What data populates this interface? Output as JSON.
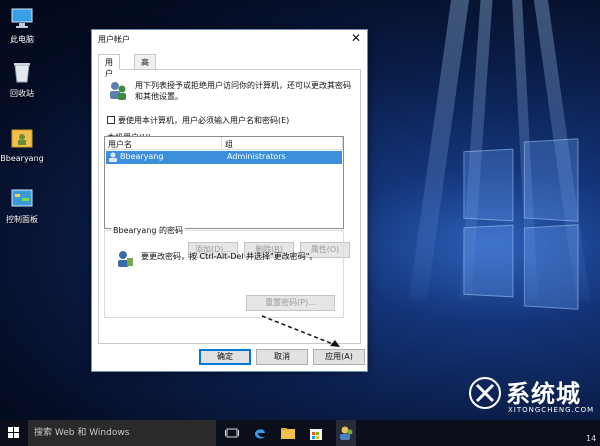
{
  "desktop": {
    "icons": [
      {
        "label": "此电脑"
      },
      {
        "label": "回收站"
      },
      {
        "label": "Bbearyang"
      },
      {
        "label": "控制面板"
      }
    ]
  },
  "dialog": {
    "title": "用户帐户",
    "close_glyph": "✕",
    "tabs": [
      {
        "label": "用户"
      },
      {
        "label": "高级"
      }
    ],
    "description": "用下列表授予或拒绝用户访问你的计算机，还可以更改其密码和其他设置。",
    "checkbox_label": "要使用本计算机，用户必须输入用户名和密码(E)",
    "checkbox_checked": false,
    "users_label": "本机用户(U):",
    "users_table": {
      "columns": [
        "用户名",
        "组"
      ],
      "rows": [
        {
          "name": "Bbearyang",
          "group": "Administrators"
        }
      ]
    },
    "buttons": {
      "add": "添加(D)...",
      "remove": "删除(R)",
      "properties": "属性(O)"
    },
    "password_group": {
      "title": "Bbearyang 的密码",
      "text": "要更改密码，按 Ctrl-Alt-Del 并选择\"更改密码\"。",
      "reset_button": "重置密码(P)..."
    },
    "footer": {
      "ok": "确定",
      "cancel": "取消",
      "apply": "应用(A)"
    }
  },
  "taskbar": {
    "search_placeholder": "搜索 Web 和 Windows",
    "clock": "14"
  },
  "watermark": {
    "brand": "系统城",
    "url": "XITONGCHENG.COM"
  }
}
